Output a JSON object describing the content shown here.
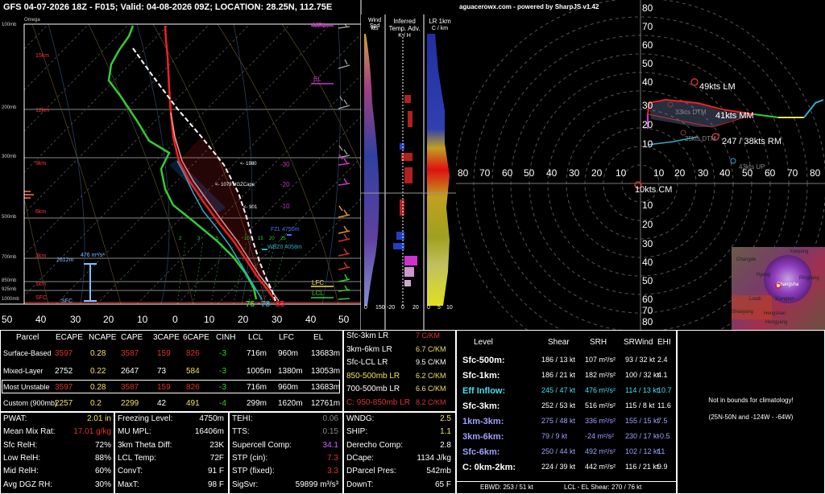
{
  "header": {
    "title": "GFS 04-07-2026 18Z - F015;  Valid: 04-08-2026 09Z;  LOCATION: 28.25N, 112.75E"
  },
  "skewt": {
    "pressure_labels": [
      "100mb",
      "200mb",
      "300mb",
      "500mb",
      "700mb",
      "850mb",
      "925mb",
      "1000mb"
    ],
    "omega_label": "Omega",
    "height_labels": [
      "15km",
      "12km",
      "9km",
      "6km",
      "3km",
      "1km",
      "SFC"
    ],
    "temp_ticks": [
      "50",
      "40",
      "30",
      "20",
      "10",
      "0",
      "10",
      "20",
      "30",
      "40",
      "50"
    ],
    "annotations": {
      "mpl": "MPL",
      "el": "EL",
      "lfc": "LFC",
      "lcl": "LCL",
      "sfc": "SFC",
      "hgz1": "<- 1980",
      "hgz2": "<- 1079 HGZCape",
      "hgz3": "<- 901",
      "t30": "-30",
      "t20": "-20",
      "t10": "-10",
      "fzl": "FZL 4750m",
      "wbz": "WBZ0 4058m",
      "srh_eff": "476 m²/s²",
      "eff_top": "2612m",
      "t_sfc": "85",
      "td_sfc": "75",
      "tw_sfc": "78",
      "mix": [
        "2",
        "3",
        "5",
        "10",
        "15",
        "20",
        "25"
      ]
    }
  },
  "panels": {
    "wind": {
      "title1": "Wind Spd",
      "title2": "kts",
      "x0": "0",
      "x1": "150"
    },
    "temp_adv": {
      "title1": "Inferred",
      "title2": "Temp. Adv.",
      "title3": "K / H",
      "x0": "-20",
      "x1": "0",
      "x2": "20"
    },
    "lr": {
      "title1": "LR 1km",
      "title2": "C / km",
      "x0": "0",
      "x1": "5",
      "x2": "10"
    }
  },
  "hodo": {
    "credit": "aguacerowx.com - powered by SharpJS v1.42",
    "x_ticks": [
      "80",
      "70",
      "60",
      "50",
      "40",
      "30",
      "20",
      "10",
      "10",
      "20",
      "30",
      "40",
      "50",
      "60",
      "70",
      "80"
    ],
    "y_ticks": [
      "80",
      "70",
      "60",
      "50",
      "40",
      "30",
      "20",
      "10",
      "10",
      "20",
      "30",
      "40",
      "50",
      "60",
      "70",
      "80"
    ],
    "lm": "49kts LM",
    "mm": "41kts MM",
    "rm": "247 / 38kts RM",
    "dtm": "33kts DTM",
    "dtm2": "25kts DTM",
    "up": "43kts UP",
    "cm": "10kts CM",
    "map_labels": [
      "Changde",
      "Yueyang",
      "Yiyang",
      "Pingjiang",
      "Changsha",
      "Loudi",
      "Xiangtan",
      "Shaoyang",
      "Hengshan",
      "Hengyang"
    ]
  },
  "parcel_table": {
    "headers": [
      "Parcel",
      "ECAPE",
      "NCAPE",
      "CAPE",
      "3CAPE",
      "6CAPE",
      "CINH",
      "LCL",
      "LFC",
      "EL"
    ],
    "rows": [
      [
        "Surface-Based",
        "3597",
        "0.28",
        "3587",
        "159",
        "826",
        "-3",
        "716m",
        "960m",
        "13683m"
      ],
      [
        "Mixed-Layer",
        "2752",
        "0.22",
        "2647",
        "73",
        "584",
        "-3",
        "1005m",
        "1380m",
        "13053m"
      ],
      [
        "Most Unstable",
        "3597",
        "0.28",
        "3587",
        "159",
        "826",
        "-3",
        "716m",
        "960m",
        "13683m"
      ],
      [
        "Custom (900mb)",
        "2257",
        "0.2",
        "2299",
        "42",
        "491",
        "-4",
        "299m",
        "1620m",
        "12761m"
      ]
    ]
  },
  "lapse_rates": [
    {
      "label": "Sfc-3km LR",
      "value": "7 C/KM",
      "color": "#e03030"
    },
    {
      "label": "3km-6km LR",
      "value": "6.7 C/KM",
      "color": "#f0e060"
    },
    {
      "label": "Sfc-LCL LR",
      "value": "9.5 C/KM",
      "color": "#ffffff"
    },
    {
      "label": "850-500mb LR",
      "value": "6.2 C/KM",
      "color": "#f0e060"
    },
    {
      "label": "700-500mb LR",
      "value": "6.6 C/KM",
      "color": "#f0e060"
    },
    {
      "label": "C: 950-850mb LR",
      "value": "8.2 C/KM",
      "color": "#e03030"
    }
  ],
  "kinematics": {
    "headers": [
      "Level",
      "Shear",
      "SRH",
      "SRWind",
      "EHI"
    ],
    "rows": [
      [
        "Sfc-500m:",
        "186 / 13 kt",
        "107 m²/s²",
        "93 / 32 kt",
        "2.4"
      ],
      [
        "Sfc-1km:",
        "186 / 21 kt",
        "182 m²/s²",
        "100 / 32 kt",
        "4.1"
      ],
      [
        "Eff Inflow:",
        "245 / 47 kt",
        "476 m²/s²",
        "114 / 13 kt",
        "10.7"
      ],
      [
        "Sfc-3km:",
        "252 / 53 kt",
        "516 m²/s²",
        "115 / 8 kt",
        "11.6"
      ],
      [
        "1km-3km:",
        "275 / 48 kt",
        "336 m²/s²",
        "155 / 15 kt",
        "7.5"
      ],
      [
        "3km-6km:",
        "79 / 9 kt",
        "-24 m²/s²",
        "230 / 17 kt",
        "-0.5"
      ],
      [
        "Sfc-6km:",
        "250 / 44 kt",
        "492 m²/s²",
        "102 / 12 kt",
        "11"
      ],
      [
        "C: 0km-2km:",
        "224 / 39 kt",
        "442 m²/s²",
        "116 / 21 kt",
        "9.9"
      ]
    ],
    "row_colors": [
      "#ffffff",
      "#ffffff",
      "#40e0f0",
      "#ffffff",
      "#9ea0ff",
      "#9ea0ff",
      "#9ea0ff",
      "#ffffff"
    ],
    "footer_ebwd": "EBWD: 253 / 51 kt",
    "footer_lcl_el": "LCL - EL Shear:   270 / 76 kt"
  },
  "climo": {
    "line1": "Not in bounds for climatology!",
    "line2": "(25N-50N and -124W - -64W)"
  },
  "thermo1": [
    [
      "PWAT:",
      "2.01 in",
      "#f0e060"
    ],
    [
      "Mean Mix Rat:",
      "17.01 g/kg",
      "#e03030"
    ],
    [
      "Sfc RelH:",
      "72%",
      "#ffffff"
    ],
    [
      "Low RelH:",
      "88%",
      "#ffffff"
    ],
    [
      "Mid RelH:",
      "60%",
      "#ffffff"
    ],
    [
      "Avg DGZ RH:",
      "30%",
      "#ffffff"
    ]
  ],
  "thermo2": [
    [
      "Freezing Level:",
      "4750m"
    ],
    [
      "MU MPL:",
      "16406m"
    ],
    [
      "3km Theta Diff:",
      "23K"
    ],
    [
      "LCL Temp:",
      "72F"
    ],
    [
      "ConvT:",
      "91 F"
    ],
    [
      "MaxT:",
      "98 F"
    ]
  ],
  "thermo3": [
    [
      "TEHI:",
      "0.06",
      "#888888"
    ],
    [
      "TTS:",
      "0.15",
      "#888888"
    ],
    [
      "Supercell Comp:",
      "34.1",
      "#cc66ff"
    ],
    [
      "STP (cin):",
      "7.3",
      "#e03030"
    ],
    [
      "STP (fixed):",
      "3.3",
      "#e03030"
    ],
    [
      "SigSvr:",
      "59899 m³/s³",
      "#ffffff"
    ]
  ],
  "thermo4": [
    [
      "WNDG:",
      "2.5",
      "#f0e060"
    ],
    [
      "SHIP:",
      "1.1",
      "#f0e060"
    ],
    [
      "Derecho Comp:",
      "2.8",
      "#ffffff"
    ],
    [
      "DCape:",
      "1134 J/kg",
      "#ffffff"
    ],
    [
      "DParcel Pres:",
      "542mb",
      "#ffffff"
    ],
    [
      "DownT:",
      "65 F",
      "#ffffff"
    ]
  ]
}
